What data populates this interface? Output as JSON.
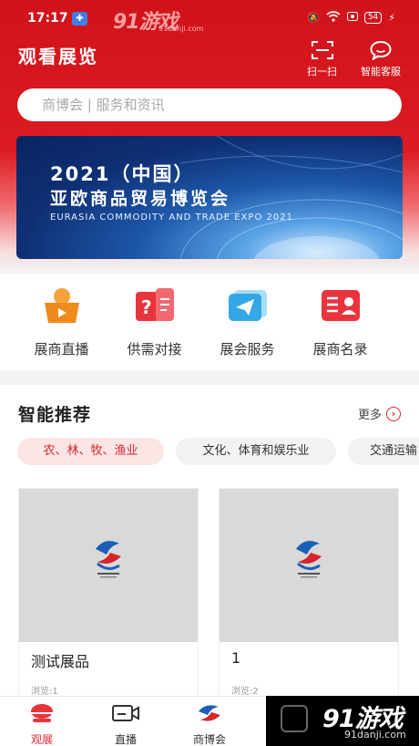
{
  "status": {
    "time": "17:17",
    "battery": "54"
  },
  "watermark": {
    "top_brand": "91游戏",
    "top_domain": "91danji.com",
    "bottom_brand": "91游戏",
    "bottom_domain": "91danji.com"
  },
  "header": {
    "title": "观看展览",
    "scan_label": "扫一扫",
    "service_label": "智能客服"
  },
  "search": {
    "placeholder": "商博会 | 服务和资讯"
  },
  "banner": {
    "line1": "2021（中国）",
    "line2": "亚欧商品贸易博览会",
    "line3": "EURASIA COMMODITY AND TRADE EXPO 2021"
  },
  "shortcuts": [
    {
      "label": "展商直播",
      "icon": "live-icon"
    },
    {
      "label": "供需对接",
      "icon": "supply-demand-icon"
    },
    {
      "label": "展会服务",
      "icon": "service-icon"
    },
    {
      "label": "展商名录",
      "icon": "directory-icon"
    }
  ],
  "recommend": {
    "title": "智能推荐",
    "more": "更多",
    "chips": [
      "农、林、牧、渔业",
      "文化、体育和娱乐业",
      "交通运输"
    ],
    "cards": [
      {
        "name": "测试展品",
        "views": "浏览:1"
      },
      {
        "name": "1",
        "views": "浏览:2"
      }
    ]
  },
  "tabs": [
    {
      "label": "观展",
      "active": true
    },
    {
      "label": "直播",
      "active": false
    },
    {
      "label": "商博会",
      "active": false
    }
  ],
  "colors": {
    "brand": "#d9262f",
    "header": "#d2121a"
  }
}
